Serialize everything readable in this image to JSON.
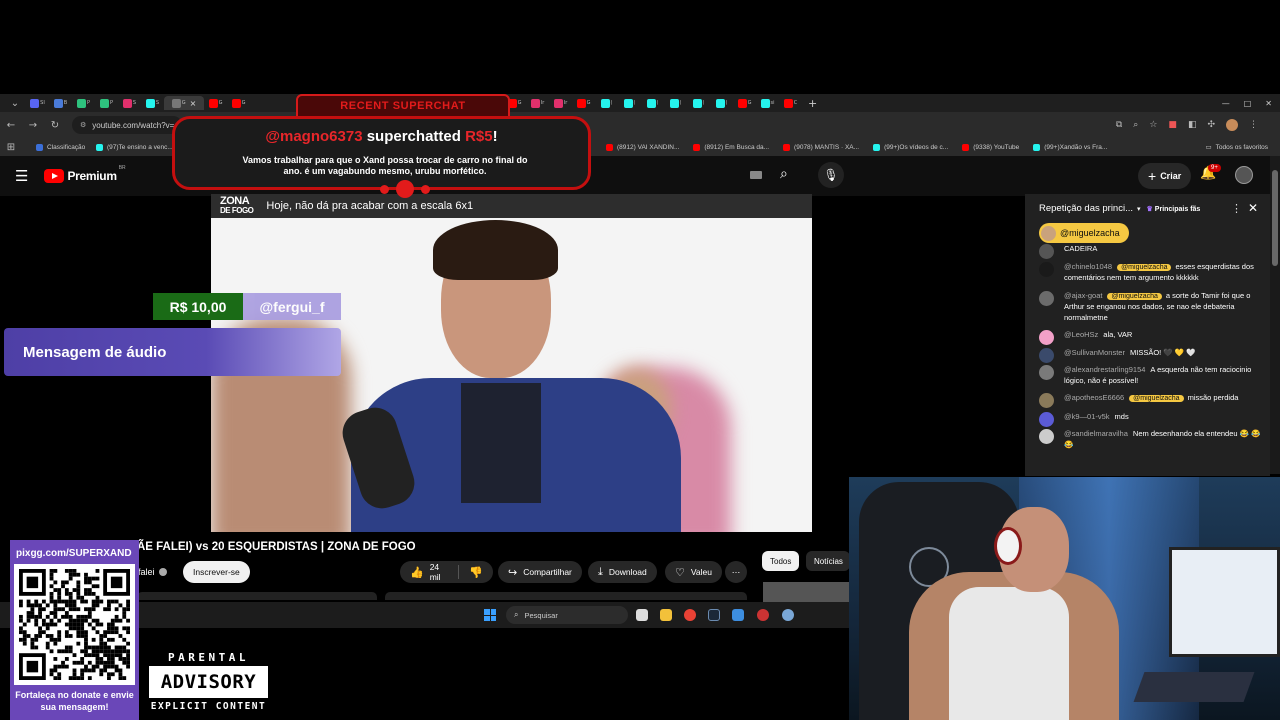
{
  "browser": {
    "url": "youtube.com/watch?v=c",
    "tabs": [
      {
        "label": "SI",
        "color": "#5865f2"
      },
      {
        "label": "B",
        "color": "#4a7bd9"
      },
      {
        "label": "P",
        "color": "#2ec27e"
      },
      {
        "label": "P",
        "color": "#2ec27e"
      },
      {
        "label": "S",
        "color": "#e1306c"
      },
      {
        "label": "S",
        "color": "#25f4ee"
      },
      {
        "label": "G",
        "color": "#777777",
        "active": true
      },
      {
        "label": "G",
        "color": "#ff0000"
      },
      {
        "label": "G",
        "color": "#ff0000"
      },
      {
        "label": "Ir",
        "color": "#25f4ee"
      },
      {
        "label": "Tr",
        "color": "#2aabee"
      },
      {
        "label": "T",
        "color": "#ff0000"
      },
      {
        "label": "S",
        "color": "#25f4ee"
      },
      {
        "label": "Sl",
        "color": "#53fc18"
      },
      {
        "label": "V",
        "color": "#4285f4"
      },
      {
        "label": "A",
        "color": "#ff0000"
      },
      {
        "label": "G",
        "color": "#ff0000"
      },
      {
        "label": "Ir",
        "color": "#e1306c"
      },
      {
        "label": "Ir",
        "color": "#e1306c"
      },
      {
        "label": "G",
        "color": "#ff0000"
      },
      {
        "label": "(",
        "color": "#25f4ee"
      },
      {
        "label": "(",
        "color": "#25f4ee"
      },
      {
        "label": "(",
        "color": "#25f4ee"
      },
      {
        "label": "(",
        "color": "#25f4ee"
      },
      {
        "label": "(",
        "color": "#25f4ee"
      },
      {
        "label": "(",
        "color": "#25f4ee"
      },
      {
        "label": "G",
        "color": "#ff0000"
      },
      {
        "label": "si",
        "color": "#25f4ee"
      },
      {
        "label": "C",
        "color": "#ff0000"
      }
    ],
    "active_tab_close": "×",
    "new_tab": "+",
    "window_controls": [
      "—",
      "□",
      "✕"
    ],
    "bookmarks": [
      {
        "label": "Classificação",
        "color": "#3b6fd8"
      },
      {
        "label": "(97)Te ensino a venc...",
        "color": "#25f4ee"
      },
      {
        "label": "(8912) VAI XANDIN...",
        "color": "#ff0000"
      },
      {
        "label": "(8912) Em Busca da...",
        "color": "#ff0000"
      },
      {
        "label": "(9078) MANTIS · XA...",
        "color": "#ff0000"
      },
      {
        "label": "(99+)Os vídeos de c...",
        "color": "#25f4ee"
      },
      {
        "label": "(9338) YouTube",
        "color": "#ff0000"
      },
      {
        "label": "(99+)Xandão vs Fra...",
        "color": "#25f4ee"
      }
    ],
    "all_bookmarks": "Todos os favoritos"
  },
  "youtube": {
    "logo_word": "Premium",
    "region": "BR",
    "create_label": "Criar",
    "bell_badge": "9+",
    "video_caption": "Hoje, não dá pra acabar com a escala 6x1",
    "show_logo_top": "ZONA",
    "show_logo_bottom": "DE FOGO",
    "video_title": "ÃE FALEI) vs 20 ESQUERDISTAS | ZONA DE FOGO",
    "channel": "falei",
    "subscribe": "Inscrever-se",
    "likes": "24 mil",
    "share": "Compartilhar",
    "download": "Download",
    "thanks": "Valeu",
    "more": "⋯",
    "chip_all": "Todos",
    "chip_news": "Notícias"
  },
  "taskbar": {
    "search_placeholder": "Pesquisar"
  },
  "superchat": {
    "header": "RECENT SUPERCHAT",
    "user": "@magno6373",
    "verb": " superchatted ",
    "amount": "R$5",
    "bang": "!",
    "message": "Vamos trabalhar para que o Xand possa trocar de carro no final do ano. é um vagabundo mesmo, urubu morfético."
  },
  "donation": {
    "amount": "R$ 10,00",
    "user": "@fergui_f",
    "audio_label": "Mensagem de áudio"
  },
  "chat": {
    "title": "Repetição das princi...",
    "fans_label": "Principais fãs",
    "pinned_user": "@miguelzacha",
    "messages": [
      {
        "author": "",
        "mention": "",
        "text": "CADEIRA",
        "color": "#555555"
      },
      {
        "author": "@chinelo1048",
        "mention": "@miguelzacha",
        "text": "esses esquerdistas dos comentários nem tem argumento kkkkkk",
        "color": "#1a1a1a"
      },
      {
        "author": "@ajax-goat",
        "mention": "@miguelzacha",
        "text": "a sorte do Tamir foi que o Arthur se enganou nos dados, se nao ele debateria normalmetne",
        "color": "#6b6b6b"
      },
      {
        "author": "@LeoHSz",
        "mention": "",
        "text": "ala, VAR",
        "color": "#f2a0c8"
      },
      {
        "author": "@SullivanMonster",
        "mention": "",
        "text": "MISSÃO! 🖤 💛 🤍",
        "color": "#3a4a6b"
      },
      {
        "author": "@alexandrestarling9154",
        "mention": "",
        "text": "A esquerda não tem raciocinio lógico, não é possível!",
        "color": "#7a7a7a"
      },
      {
        "author": "@apotheosE6666",
        "mention": "@miguelzacha",
        "text": "missão perdida",
        "color": "#8a7a5a"
      },
      {
        "author": "@k9—01-v5k",
        "mention": "",
        "text": "mds",
        "color": "#5b5bd6"
      },
      {
        "author": "@sandielmaravilha",
        "mention": "",
        "text": "Nem desenhando ela entendeu 😂 😂 😂",
        "color": "#cccccc"
      }
    ]
  },
  "qr": {
    "url": "pixgg.com/SUPERXAND",
    "caption": "Fortaleça no donate e envie sua mensagem!"
  },
  "advisory": {
    "top": "PARENTAL",
    "middle": "ADVISORY",
    "bottom": "EXPLICIT CONTENT"
  }
}
